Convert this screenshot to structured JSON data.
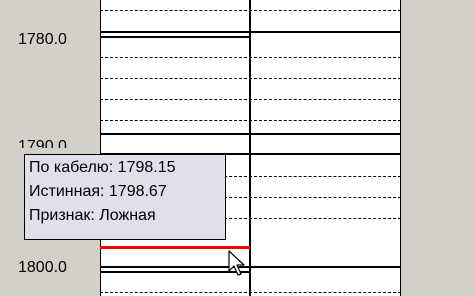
{
  "depth_labels": {
    "top": "1780.0",
    "middle": "1790.0",
    "bottom": "1800.0"
  },
  "tooltip": {
    "cable_depth": "По кабелю: 1798.15",
    "true_depth": "Истинная: 1798.67",
    "flag": "Признак: Ложная"
  },
  "colors": {
    "background": "#d4d0c8",
    "track": "#ffffff",
    "marker": "#ff0000",
    "tooltip_bg": "#e0e0ea"
  },
  "icons": {
    "cursor": "arrow-cursor-icon"
  }
}
